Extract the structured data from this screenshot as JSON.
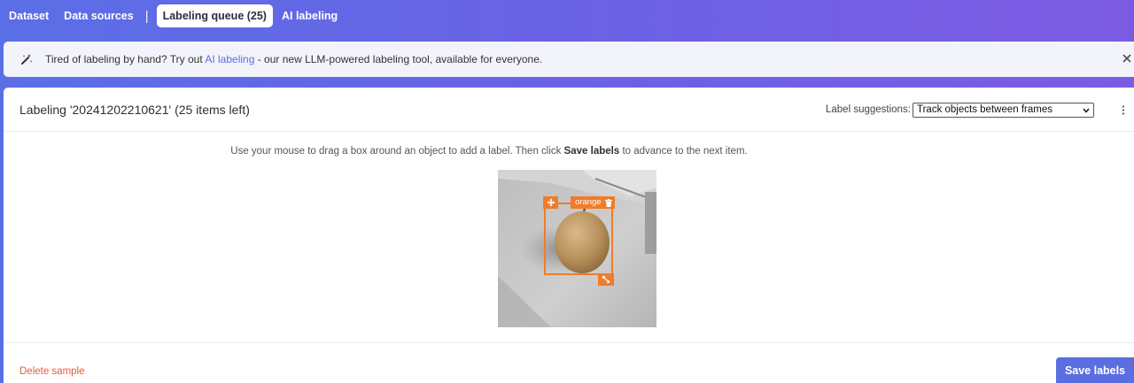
{
  "nav": {
    "items": [
      {
        "label": "Dataset"
      },
      {
        "label": "Data sources"
      },
      {
        "label": "Labeling queue (25)"
      },
      {
        "label": "AI labeling"
      }
    ],
    "separator": "|"
  },
  "banner": {
    "icon": "magic-wand-icon",
    "text_before": "Tired of labeling by hand? Try out ",
    "link": "AI labeling",
    "text_after": " - our new LLM-powered labeling tool, available for everyone.",
    "close_icon": "close-icon"
  },
  "labeling": {
    "title": "Labeling '20241202210621' (25 items left)",
    "suggestions_label": "Label suggestions:",
    "suggestions_value": "Track objects between frames",
    "instructions_before": "Use your mouse to drag a box around an object to add a label. Then click ",
    "instructions_bold": "Save labels",
    "instructions_after": " to advance to the next item.",
    "box_label": "orange",
    "delete_label": "Delete sample",
    "save_label": "Save labels"
  },
  "colors": {
    "accent": "#5b6ee1",
    "box": "#f07c2a",
    "danger": "#e8593c"
  }
}
